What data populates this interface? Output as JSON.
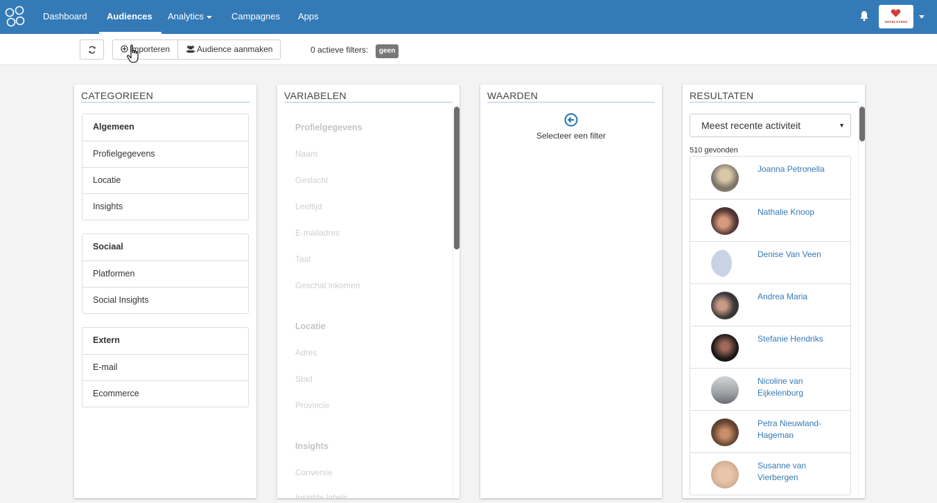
{
  "nav": {
    "items": [
      {
        "label": "Dashboard"
      },
      {
        "label": "Audiences",
        "active": true
      },
      {
        "label": "Analytics",
        "dropdown": true
      },
      {
        "label": "Campagnes"
      },
      {
        "label": "Apps"
      }
    ],
    "brand_text": "SHOELOVERS",
    "accent_color": "#337ab7"
  },
  "toolbar": {
    "import_label": "Importeren",
    "audience_label": "Audience aanmaken",
    "filters_label": "0 actieve filters:",
    "filters_badge": "geen"
  },
  "categories": {
    "title": "CATEGORIEEN",
    "groups": [
      {
        "items": [
          "Algemeen",
          "Profielgegevens",
          "Locatie",
          "Insights"
        ]
      },
      {
        "items": [
          "Sociaal",
          "Platformen",
          "Social Insights"
        ]
      },
      {
        "items": [
          "Extern",
          "E-mail",
          "Ecommerce"
        ]
      }
    ]
  },
  "variables": {
    "title": "VARIABELEN",
    "sections": [
      {
        "heading": "Profielgegevens",
        "items": [
          "Naam",
          "Geslacht",
          "Leeftijd",
          "E-mailadres",
          "Taal",
          "Geschat inkomen"
        ]
      },
      {
        "heading": "Locatie",
        "items": [
          "Adres",
          "Stad",
          "Provincie"
        ]
      },
      {
        "heading": "Insights",
        "items": [
          "Conversie",
          "Insights labels"
        ]
      }
    ]
  },
  "values": {
    "title": "WAARDEN",
    "empty_text": "Selecteer een filter"
  },
  "results": {
    "title": "RESULTATEN",
    "sort_value": "Meest recente activiteit",
    "found_text": "510 gevonden",
    "people": [
      {
        "name": "Joanna Petronella",
        "avatar_color": "#9b8f80"
      },
      {
        "name": "Nathalie Knoop",
        "avatar_color": "#5b3a3a"
      },
      {
        "name": "Denise Van Veen",
        "avatar_color": "#c8d3e6"
      },
      {
        "name": "Andrea Maria",
        "avatar_color": "#3d3a3a"
      },
      {
        "name": "Stefanie Hendriks",
        "avatar_color": "#1e1818"
      },
      {
        "name": "Nicoline van Eijkelenburg",
        "avatar_color": "#9ea2a6"
      },
      {
        "name": "Petra Nieuwland-Hageman",
        "avatar_color": "#6b4a35"
      },
      {
        "name": "Susanne van Vierbergen",
        "avatar_color": "#d9b59a"
      }
    ]
  }
}
